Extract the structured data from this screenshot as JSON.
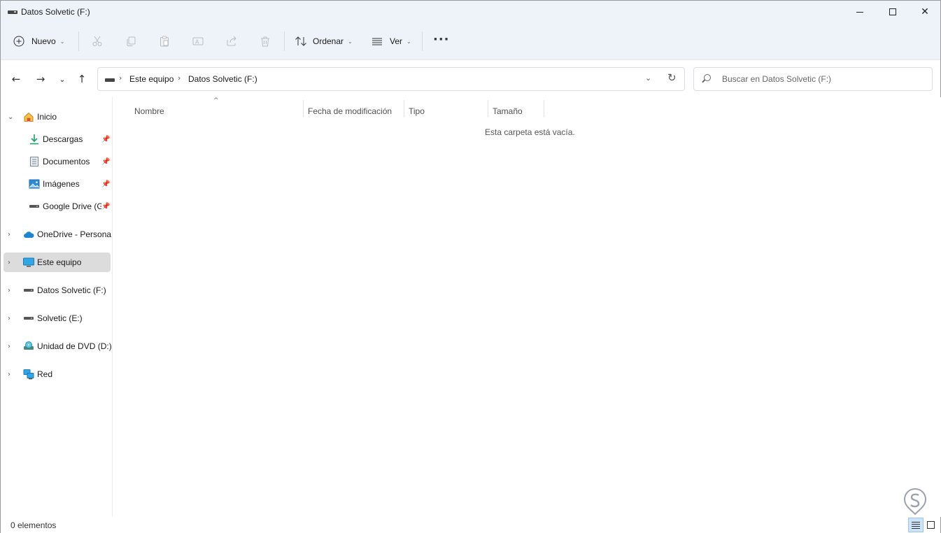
{
  "window": {
    "title": "Datos Solvetic (F:)"
  },
  "toolbar": {
    "new_label": "Nuevo",
    "sort_label": "Ordenar",
    "view_label": "Ver",
    "more_label": "···",
    "icons": [
      "plus-circle-icon",
      "cut-icon",
      "copy-icon",
      "paste-icon",
      "rename-icon",
      "share-icon",
      "delete-icon",
      "sort-icon",
      "view-icon"
    ]
  },
  "address": {
    "crumbs": [
      "Este equipo",
      "Datos Solvetic (F:)"
    ],
    "search_placeholder": "Buscar en Datos Solvetic (F:)"
  },
  "sidebar": {
    "items": [
      {
        "label": "Inicio",
        "icon": "home-icon",
        "expanded": true
      },
      {
        "label": "Descargas",
        "icon": "download-icon",
        "pinned": true
      },
      {
        "label": "Documentos",
        "icon": "document-icon",
        "pinned": true
      },
      {
        "label": "Imágenes",
        "icon": "image-icon",
        "pinned": true
      },
      {
        "label": "Google Drive (G:)",
        "icon": "drive-icon",
        "pinned": true
      },
      {
        "label": "OneDrive - Personal",
        "icon": "cloud-icon"
      },
      {
        "label": "Este equipo",
        "icon": "computer-icon",
        "selected": true
      },
      {
        "label": "Datos Solvetic (F:)",
        "icon": "drive-icon"
      },
      {
        "label": "Solvetic (E:)",
        "icon": "drive-icon"
      },
      {
        "label": "Unidad de DVD (D:)",
        "icon": "dvd-icon"
      },
      {
        "label": "Red",
        "icon": "network-icon"
      }
    ]
  },
  "content": {
    "columns": [
      "Nombre",
      "Fecha de modificación",
      "Tipo",
      "Tamaño"
    ],
    "empty_message": "Esta carpeta está vacía."
  },
  "status": {
    "count": "0 elementos"
  },
  "colors": {
    "accent": "#0067c0",
    "toolbar_bg": "#eef3fa",
    "selection": "#dcdcdc"
  }
}
